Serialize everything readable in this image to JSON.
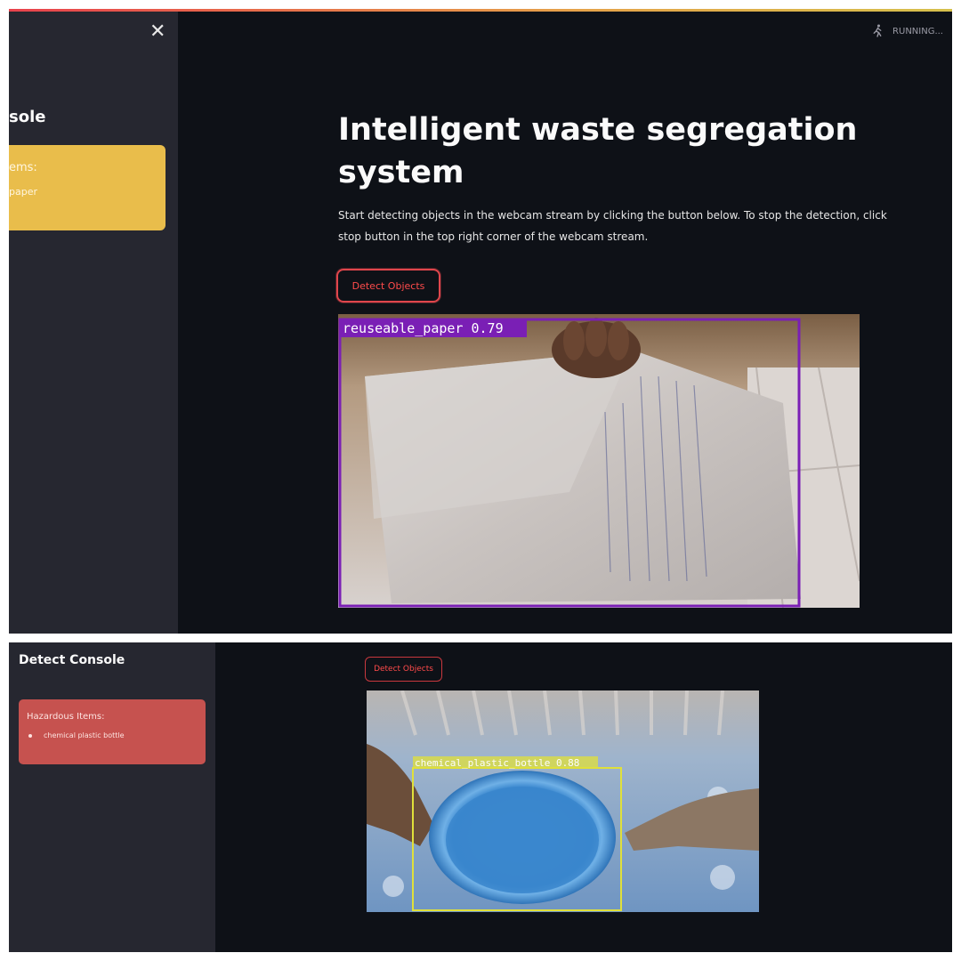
{
  "panel1": {
    "sidebar": {
      "title_fragment": "sole",
      "card": {
        "heading": "ems:",
        "item": "paper"
      }
    },
    "status": {
      "label": "RUNNING..."
    },
    "main": {
      "title": "Intelligent waste segregation system",
      "description": "Start detecting objects in the webcam stream by clicking the button below. To stop the detection, click stop button in the top right corner of the webcam stream.",
      "button_label": "Detect Objects"
    },
    "webcam": {
      "detection": {
        "label": "reuseable_paper 0.79",
        "color": "#7a1fb5"
      }
    }
  },
  "panel2": {
    "sidebar": {
      "title": "Detect Console",
      "card": {
        "heading": "Hazardous Items:",
        "items": [
          "chemical plastic bottle"
        ]
      }
    },
    "main": {
      "button_label": "Detect Objects"
    },
    "webcam": {
      "detection": {
        "label": "chemical_plastic_bottle 0.88",
        "color": "#e0e03a"
      }
    }
  },
  "colors": {
    "app_bg": "#0e1117",
    "sidebar_bg": "#262730",
    "warning_card": "#e9bd4b",
    "danger_card": "#c6524f",
    "accent": "#ff4b4b"
  }
}
